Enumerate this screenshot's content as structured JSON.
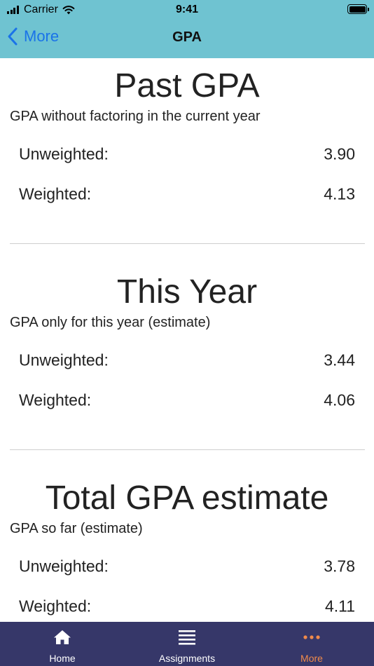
{
  "status_bar": {
    "carrier": "Carrier",
    "time": "9:41"
  },
  "nav": {
    "back_label": "More",
    "title": "GPA"
  },
  "sections": [
    {
      "title": "Past GPA",
      "subtitle": "GPA without factoring in the current year",
      "rows": [
        {
          "label": "Unweighted:",
          "value": "3.90"
        },
        {
          "label": "Weighted:",
          "value": "4.13"
        }
      ]
    },
    {
      "title": "This Year",
      "subtitle": "GPA only for this year (estimate)",
      "rows": [
        {
          "label": "Unweighted:",
          "value": "3.44"
        },
        {
          "label": "Weighted:",
          "value": "4.06"
        }
      ]
    },
    {
      "title": "Total GPA estimate",
      "subtitle": "GPA so far (estimate)",
      "rows": [
        {
          "label": "Unweighted:",
          "value": "3.78"
        },
        {
          "label": "Weighted:",
          "value": "4.11"
        }
      ]
    }
  ],
  "tabs": [
    {
      "label": "Home",
      "icon": "home-icon"
    },
    {
      "label": "Assignments",
      "icon": "list-icon"
    },
    {
      "label": "More",
      "icon": "more-icon"
    }
  ],
  "colors": {
    "nav_background": "#6fc3d1",
    "back_link": "#1a73e8",
    "tab_bar": "#363769",
    "tab_active": "#f08a4b"
  }
}
